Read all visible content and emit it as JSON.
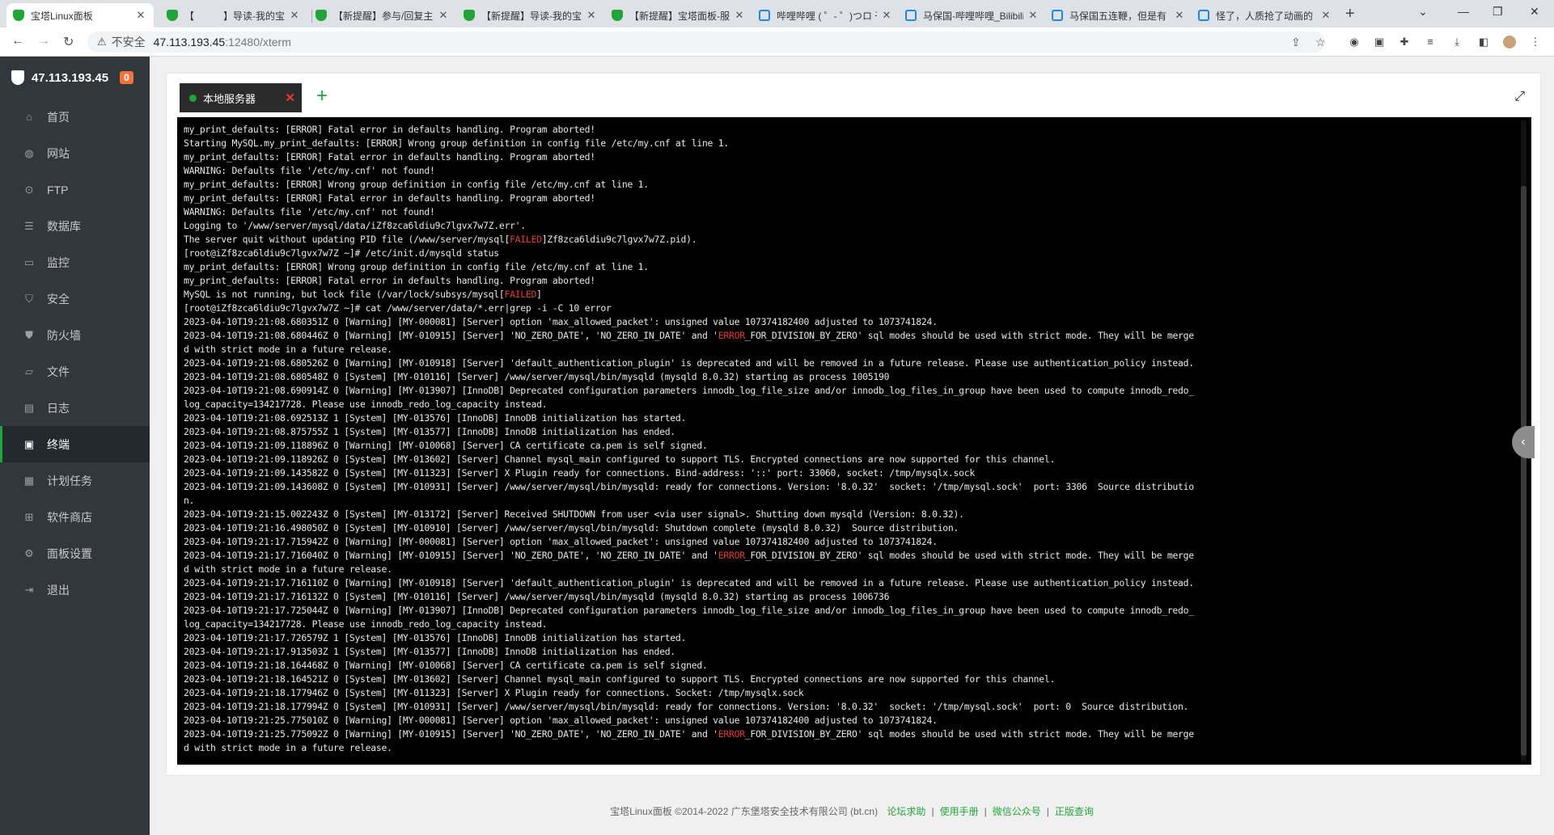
{
  "browser": {
    "tabs": [
      {
        "title": "宝塔Linux面板",
        "icon": "bt-shield-icon",
        "active": true
      },
      {
        "title": "【　　　】导读-我的宝",
        "icon": "bt-shield-icon"
      },
      {
        "title": "【新提醒】参与/回复主",
        "icon": "bt-shield-icon"
      },
      {
        "title": "【新提醒】导读-我的宝",
        "icon": "bt-shield-icon"
      },
      {
        "title": "【新提醒】宝塔面板-服",
        "icon": "bt-shield-icon"
      },
      {
        "title": "哔哩哔哩 ( ゜- ゜)つロ 干",
        "icon": "bilibili-icon"
      },
      {
        "title": "马保国-哔哩哔哩_Bilibili",
        "icon": "bilibili-icon"
      },
      {
        "title": "马保国五连鞭，但是有",
        "icon": "bilibili-icon"
      },
      {
        "title": "怪了，人质抢了动画的",
        "icon": "bilibili-icon"
      }
    ],
    "insecure_label": "不安全",
    "url_host": "47.113.193.45",
    "url_path": ":12480/xterm"
  },
  "sidebar": {
    "server_ip": "47.113.193.45",
    "badge": "0",
    "items": [
      {
        "label": "首页",
        "icon": "home-icon"
      },
      {
        "label": "网站",
        "icon": "globe-icon"
      },
      {
        "label": "FTP",
        "icon": "ftp-icon"
      },
      {
        "label": "数据库",
        "icon": "database-icon"
      },
      {
        "label": "监控",
        "icon": "monitor-icon"
      },
      {
        "label": "安全",
        "icon": "shield-icon"
      },
      {
        "label": "防火墙",
        "icon": "firewall-icon"
      },
      {
        "label": "文件",
        "icon": "folder-icon"
      },
      {
        "label": "日志",
        "icon": "log-icon"
      },
      {
        "label": "终端",
        "icon": "terminal-icon",
        "active": true
      },
      {
        "label": "计划任务",
        "icon": "calendar-icon"
      },
      {
        "label": "软件商店",
        "icon": "grid-icon"
      },
      {
        "label": "面板设置",
        "icon": "gear-icon"
      },
      {
        "label": "退出",
        "icon": "logout-icon"
      }
    ]
  },
  "terminal": {
    "tab_label": "本地服务器",
    "lines": [
      "my_print_defaults: [ERROR] Fatal error in defaults handling. Program aborted!",
      "Starting MySQL.my_print_defaults: [ERROR] Wrong group definition in config file /etc/my.cnf at line 1.",
      "my_print_defaults: [ERROR] Fatal error in defaults handling. Program aborted!",
      "WARNING: Defaults file '/etc/my.cnf' not found!",
      "my_print_defaults: [ERROR] Wrong group definition in config file /etc/my.cnf at line 1.",
      "my_print_defaults: [ERROR] Fatal error in defaults handling. Program aborted!",
      "WARNING: Defaults file '/etc/my.cnf' not found!",
      "Logging to '/www/server/mysql/data/iZf8zca6ldiu9c7lgvx7w7Z.err'.",
      "The server quit without updating PID file (/www/server/mysql[FAILED]Zf8zca6ldiu9c7lgvx7w7Z.pid).",
      "[root@iZf8zca6ldiu9c7lgvx7w7Z ~]# /etc/init.d/mysqld status",
      "my_print_defaults: [ERROR] Wrong group definition in config file /etc/my.cnf at line 1.",
      "my_print_defaults: [ERROR] Fatal error in defaults handling. Program aborted!",
      "MySQL is not running, but lock file (/var/lock/subsys/mysql[FAILED]",
      "[root@iZf8zca6ldiu9c7lgvx7w7Z ~]# cat /www/server/data/*.err|grep -i -C 10 error",
      "2023-04-10T19:21:08.680351Z 0 [Warning] [MY-000081] [Server] option 'max_allowed_packet': unsigned value 107374182400 adjusted to 1073741824.",
      "2023-04-10T19:21:08.680446Z 0 [Warning] [MY-010915] [Server] 'NO_ZERO_DATE', 'NO_ZERO_IN_DATE' and 'ERROR_FOR_DIVISION_BY_ZERO' sql modes should be used with strict mode. They will be merge",
      "d with strict mode in a future release.",
      "2023-04-10T19:21:08.680526Z 0 [Warning] [MY-010918] [Server] 'default_authentication_plugin' is deprecated and will be removed in a future release. Please use authentication_policy instead.",
      "2023-04-10T19:21:08.680548Z 0 [System] [MY-010116] [Server] /www/server/mysql/bin/mysqld (mysqld 8.0.32) starting as process 1005190",
      "2023-04-10T19:21:08.690914Z 0 [Warning] [MY-013907] [InnoDB] Deprecated configuration parameters innodb_log_file_size and/or innodb_log_files_in_group have been used to compute innodb_redo_",
      "log_capacity=134217728. Please use innodb_redo_log_capacity instead.",
      "2023-04-10T19:21:08.692513Z 1 [System] [MY-013576] [InnoDB] InnoDB initialization has started.",
      "2023-04-10T19:21:08.875755Z 1 [System] [MY-013577] [InnoDB] InnoDB initialization has ended.",
      "2023-04-10T19:21:09.118896Z 0 [Warning] [MY-010068] [Server] CA certificate ca.pem is self signed.",
      "2023-04-10T19:21:09.118926Z 0 [System] [MY-013602] [Server] Channel mysql_main configured to support TLS. Encrypted connections are now supported for this channel.",
      "2023-04-10T19:21:09.143582Z 0 [System] [MY-011323] [Server] X Plugin ready for connections. Bind-address: '::' port: 33060, socket: /tmp/mysqlx.sock",
      "2023-04-10T19:21:09.143608Z 0 [System] [MY-010931] [Server] /www/server/mysql/bin/mysqld: ready for connections. Version: '8.0.32'  socket: '/tmp/mysql.sock'  port: 3306  Source distributio",
      "n.",
      "2023-04-10T19:21:15.002243Z 0 [System] [MY-013172] [Server] Received SHUTDOWN from user <via user signal>. Shutting down mysqld (Version: 8.0.32).",
      "2023-04-10T19:21:16.498050Z 0 [System] [MY-010910] [Server] /www/server/mysql/bin/mysqld: Shutdown complete (mysqld 8.0.32)  Source distribution.",
      "2023-04-10T19:21:17.715942Z 0 [Warning] [MY-000081] [Server] option 'max_allowed_packet': unsigned value 107374182400 adjusted to 1073741824.",
      "2023-04-10T19:21:17.716040Z 0 [Warning] [MY-010915] [Server] 'NO_ZERO_DATE', 'NO_ZERO_IN_DATE' and 'ERROR_FOR_DIVISION_BY_ZERO' sql modes should be used with strict mode. They will be merge",
      "d with strict mode in a future release.",
      "2023-04-10T19:21:17.716110Z 0 [Warning] [MY-010918] [Server] 'default_authentication_plugin' is deprecated and will be removed in a future release. Please use authentication_policy instead.",
      "2023-04-10T19:21:17.716132Z 0 [System] [MY-010116] [Server] /www/server/mysql/bin/mysqld (mysqld 8.0.32) starting as process 1006736",
      "2023-04-10T19:21:17.725044Z 0 [Warning] [MY-013907] [InnoDB] Deprecated configuration parameters innodb_log_file_size and/or innodb_log_files_in_group have been used to compute innodb_redo_",
      "log_capacity=134217728. Please use innodb_redo_log_capacity instead.",
      "2023-04-10T19:21:17.726579Z 1 [System] [MY-013576] [InnoDB] InnoDB initialization has started.",
      "2023-04-10T19:21:17.913503Z 1 [System] [MY-013577] [InnoDB] InnoDB initialization has ended.",
      "2023-04-10T19:21:18.164468Z 0 [Warning] [MY-010068] [Server] CA certificate ca.pem is self signed.",
      "2023-04-10T19:21:18.164521Z 0 [System] [MY-013602] [Server] Channel mysql_main configured to support TLS. Encrypted connections are now supported for this channel.",
      "2023-04-10T19:21:18.177946Z 0 [System] [MY-011323] [Server] X Plugin ready for connections. Socket: /tmp/mysqlx.sock",
      "2023-04-10T19:21:18.177994Z 0 [System] [MY-010931] [Server] /www/server/mysql/bin/mysqld: ready for connections. Version: '8.0.32'  socket: '/tmp/mysql.sock'  port: 0  Source distribution.",
      "2023-04-10T19:21:25.775010Z 0 [Warning] [MY-000081] [Server] option 'max_allowed_packet': unsigned value 107374182400 adjusted to 1073741824.",
      "2023-04-10T19:21:25.775092Z 0 [Warning] [MY-010915] [Server] 'NO_ZERO_DATE', 'NO_ZERO_IN_DATE' and 'ERROR_FOR_DIVISION_BY_ZERO' sql modes should be used with strict mode. They will be merge",
      "d with strict mode in a future release."
    ]
  },
  "footer": {
    "copyright": "宝塔Linux面板 ©2014-2022 广东堡塔安全技术有限公司 (bt.cn)",
    "links": [
      "论坛求助",
      "使用手册",
      "微信公众号",
      "正版查询"
    ]
  },
  "colors": {
    "accent": "#20a53a",
    "error_highlight": "#e53935",
    "sidebar_bg": "#32373b"
  }
}
